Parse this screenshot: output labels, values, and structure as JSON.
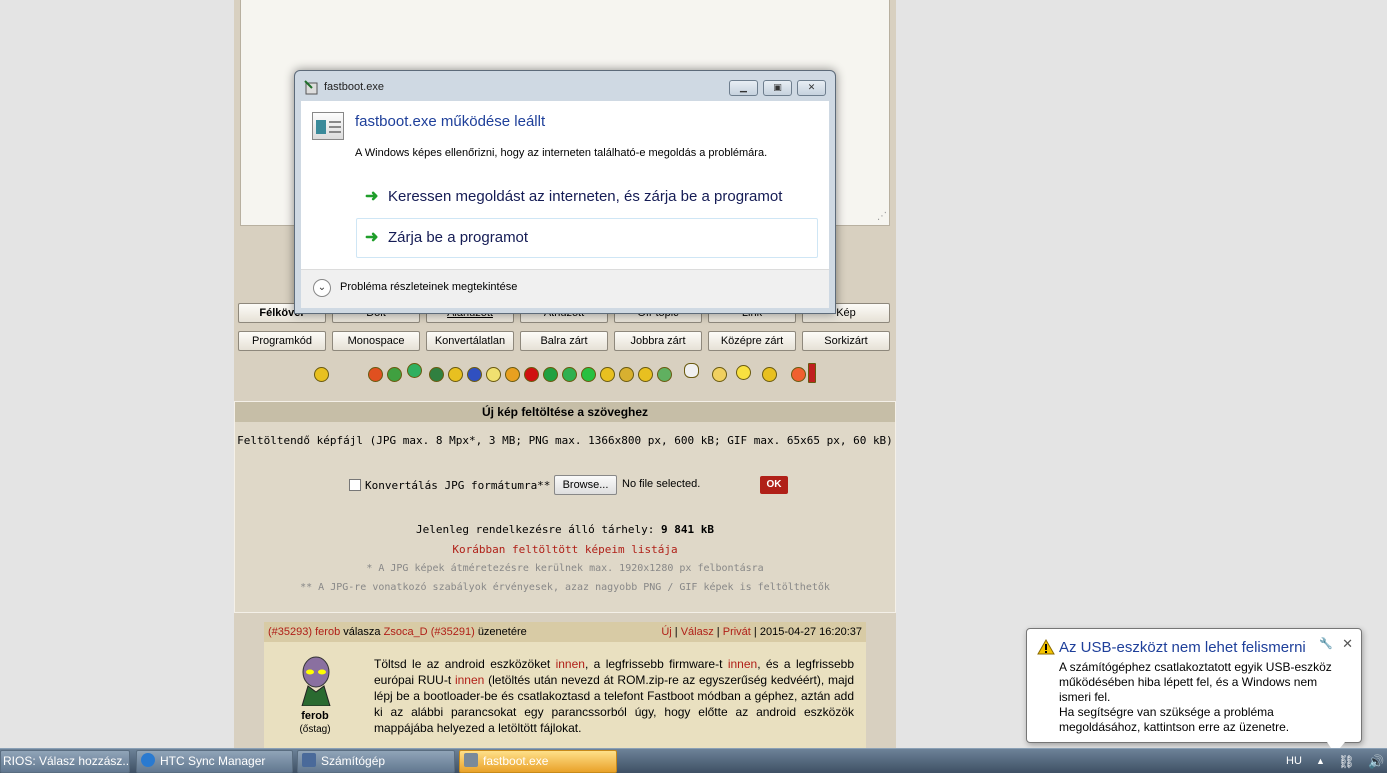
{
  "forum": {
    "format_row1": [
      "Félkövér",
      "Dőlt",
      "Aláhúzott",
      "Áthúzott",
      "Off-topic",
      "Link",
      "Kép"
    ],
    "format_row2": [
      "Programkód",
      "Monospace",
      "Konvertálatlan",
      "Balra zárt",
      "Jobbra zárt",
      "Középre zárt",
      "Sorkizárt"
    ],
    "upload": {
      "header": "Új kép feltöltése a szöveghez",
      "file_info": "Feltöltendő képfájl (JPG max. 8 Mpx*, 3 MB; PNG max. 1366x800 px, 600 kB; GIF max. 65x65 px, 60 kB)",
      "convert_label": "Konvertálás JPG formátumra**",
      "browse_label": "Browse...",
      "no_file": "No file selected.",
      "ok_label": "OK",
      "storage_label": "Jelenleg rendelkezésre álló tárhely:",
      "storage_value": "9 841 kB",
      "my_images_link": "Korábban feltöltött képeim listája",
      "note1": "* A JPG képek átméretezésre kerülnek max. 1920x1280 px felbontásra",
      "note2": "** A JPG-re vonatkozó szabályok érvényesek, azaz nagyobb PNG / GIF képek is feltölthetők"
    },
    "post": {
      "post_id": "(#35293)",
      "author": "ferob",
      "reply_word": "válasza",
      "reply_to": "Zsoca_D",
      "reply_to_id": "(#35291)",
      "reply_suffix": "üzenetére",
      "action_new": "Új",
      "action_reply": "Válasz",
      "action_private": "Privát",
      "timestamp": "2015-04-27 16:20:37",
      "user_name": "ferob",
      "user_rank": "(őstag)",
      "text_1": "Töltsd le az android eszközöket ",
      "link_1": "innen",
      "text_2": ", a legfrissebb firmware-t ",
      "link_2": "innen",
      "text_3": ", és a legfrissebb európai RUU-t ",
      "link_3": "innen",
      "text_4": " (letöltés után nevezd át ROM.zip-re az egyszerűség kedvéért), majd lépj be a bootloader-be és csatlakoztasd a telefont Fastboot módban a géphez, aztán add ki az alábbi parancsokat egy parancssorból úgy, hogy előtte az android eszközök mappájába helyezed a letöltött fájlokat."
    }
  },
  "dialog": {
    "title": "fastboot.exe",
    "heading": "fastboot.exe működése leállt",
    "message": "A Windows képes ellenőrizni, hogy az interneten található-e megoldás a problémára.",
    "option_search": "Keressen megoldást az interneten, és zárja be a programot",
    "option_close": "Zárja be a programot",
    "details": "Probléma részleteinek megtekintése"
  },
  "balloon": {
    "title": "Az USB-eszközt nem lehet felismerni",
    "line1": "A számítógéphez csatlakoztatott egyik USB-eszköz működésében hiba lépett fel, és a Windows nem ismeri fel.",
    "line2": "Ha segítségre van szüksége a probléma megoldásához, kattintson erre az üzenetre."
  },
  "taskbar": {
    "items": [
      "RIOS: Válasz hozzász...",
      "HTC Sync Manager",
      "Számítógép",
      "fastboot.exe"
    ],
    "language": "HU"
  },
  "colors": {
    "accent_red": "#b02018",
    "dialog_heading": "#1e3f9a",
    "command_arrow": "#1f9e2a",
    "taskbar_active": "#e9a22a"
  }
}
